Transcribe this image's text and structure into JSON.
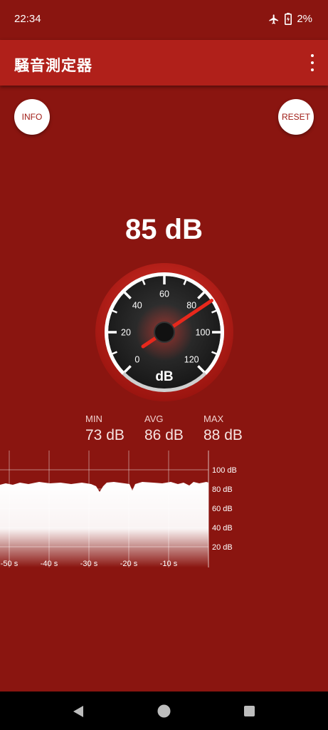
{
  "status_bar": {
    "time": "22:34",
    "battery": "2%",
    "icons": [
      "airplane-icon",
      "battery-icon"
    ]
  },
  "app_bar": {
    "title": "騒音測定器",
    "menu_icon": "overflow-menu-icon"
  },
  "buttons": {
    "info": "INFO",
    "reset": "RESET"
  },
  "reading": {
    "value_text": "85 dB",
    "value": 85
  },
  "gauge": {
    "unit": "dB",
    "min": 0,
    "max": 120,
    "ticks": [
      "0",
      "20",
      "40",
      "60",
      "80",
      "100",
      "120"
    ]
  },
  "stats": {
    "min_label": "MIN",
    "min_value": "73 dB",
    "avg_label": "AVG",
    "avg_value": "86 dB",
    "max_label": "MAX",
    "max_value": "88 dB"
  },
  "history_chart": {
    "y_labels": [
      "100 dB",
      "80 dB",
      "60 dB",
      "40 dB",
      "20 dB"
    ],
    "x_labels": [
      "-50 s",
      "-40 s",
      "-30 s",
      "-20 s",
      "-10 s"
    ]
  },
  "colors": {
    "background": "#8a1510",
    "app_bar": "#b0201a",
    "needle": "#e8281c"
  }
}
